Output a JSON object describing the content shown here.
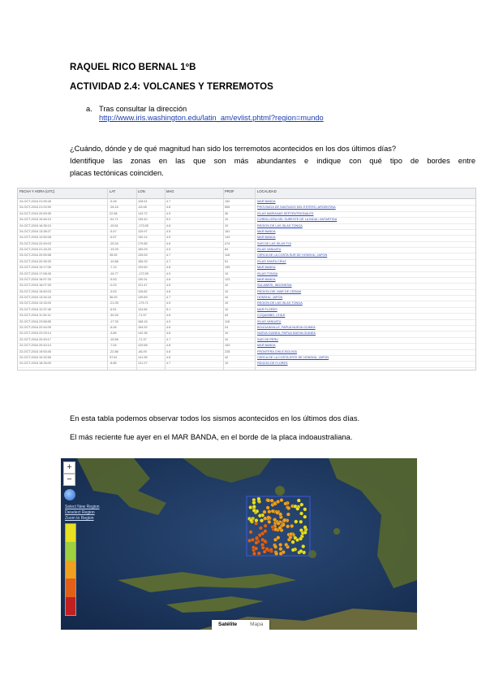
{
  "header": {
    "name": "RAQUEL RICO BERNAL 1ºB",
    "activity": "ACTIVIDAD 2.4: VOLCANES Y TERREMOTOS"
  },
  "list": {
    "marker": "a.",
    "text": "Tras consultar la dirección",
    "url": "http://www.iris.washington.edu/latin_am/evlist.phtml?region=mundo"
  },
  "question": {
    "line1": "¿Cuándo, dónde y de qué magnitud han sido los terremotos acontecidos en los dos últimos días?",
    "line2": "Identifique las zonas en las que son más abundantes e indique con qué tipo de bordes entre",
    "line3": "placas tectónicas coinciden."
  },
  "table": {
    "headers": [
      "FECHA Y HORA (UTC)",
      "LAT",
      "LON",
      "MAG",
      "PROF",
      "LOCALIDAD"
    ],
    "rows": [
      [
        "24-OCT-2016 21:59:45",
        "-5.28",
        "128.51",
        "4.7",
        "152",
        "MAR BANDA"
      ],
      [
        "24-OCT-2016 21:02:59",
        "-26.16",
        "-63.48",
        "4.8",
        "555",
        "PROVINCIA DE SANTIAGO DEL ESTERO, ARGENTINA"
      ],
      [
        "24-OCT-2016 20:59:35",
        "22.98",
        "143.72",
        "4.9",
        "30",
        "ISLAS MARIANAS SEPTENTRIONALES"
      ],
      [
        "24-OCT-2016 19:46:10",
        "-51.71",
        "139.40",
        "5.0",
        "10",
        "CORDILLERA DEL SURESTE DE LA INDIA / ANTARTIDA"
      ],
      [
        "24-OCT-2016 16:35:10",
        "-15.61",
        "-173.05",
        "4.8",
        "10",
        "REGION DE LAS ISLAS TONGA"
      ],
      [
        "24-OCT-2016 13:38:27",
        "-5.47",
        "129.97",
        "4.5",
        "161",
        "MAR BANDA"
      ],
      [
        "24-OCT-2016 12:50:08",
        "-5.57",
        "130.14",
        "4.9",
        "143",
        "MAR BANDA"
      ],
      [
        "23-OCT-2016 22:49:03",
        "-25.34",
        "179.85",
        "4.6",
        "474",
        "SUR DE LAS ISLAS FIJI"
      ],
      [
        "23-OCT-2016 21:16:20",
        "-19.29",
        "169.29",
        "4.5",
        "84",
        "ISLAS VANUATU"
      ],
      [
        "23-OCT-2016 20:59:58",
        "35.05",
        "139.53",
        "4.7",
        "118",
        "CERCA DE LA COSTA SUR DE HONSHU, JAPON"
      ],
      [
        "23-OCT-2016 20:35:33",
        "-10.88",
        "165.33",
        "4.7",
        "51",
        "ISLAS SANTA CRUZ"
      ],
      [
        "23-OCT-2016 19:17:06",
        "-7.13",
        "129.60",
        "4.8",
        "155",
        "MAR BANDA"
      ],
      [
        "23-OCT-2016 17:08:45",
        "-16.77",
        "-172.59",
        "4.9",
        "10",
        "ISLAS TONGA"
      ],
      [
        "23-OCT-2016 16:57:33",
        "-5.53",
        "130.31",
        "4.6",
        "123",
        "MAR BANDA"
      ],
      [
        "23-OCT-2016 16:07:39",
        "-0.23",
        "121.47",
        "4.5",
        "10",
        "SULAWESI, INDONESIA"
      ],
      [
        "23-OCT-2016 15:50:03",
        "-3.53",
        "126.82",
        "4.6",
        "10",
        "REGION DEL MAR DE CERAM"
      ],
      [
        "23-OCT-2016 13:34:16",
        "36.09",
        "139.89",
        "4.7",
        "44",
        "HONSHU, JAPON"
      ],
      [
        "23-OCT-2016 13:15:00",
        "-21.05",
        "-175.71",
        "4.9",
        "10",
        "REGION DE LAS ISLAS TONGA"
      ],
      [
        "23-OCT-2016 12:37:46",
        "-6.51",
        "124.84",
        "5.1",
        "10",
        "MAR FLORES"
      ],
      [
        "23-OCT-2016 11:33:14",
        "-30.26",
        "-71.57",
        "4.6",
        "43",
        "COQUIMBO, CHILE"
      ],
      [
        "22-OCT-2016 23:58:55",
        "-17.33",
        "168.16",
        "4.9",
        "116",
        "ISLAS VANUATU"
      ],
      [
        "22-OCT-2016 22:44:09",
        "-6.06",
        "154.92",
        "4.6",
        "24",
        "BOUGAINVILLE, PAPUA NUEVA GUINEA"
      ],
      [
        "22-OCT-2016 22:03:14",
        "-3.86",
        "142.36",
        "4.6",
        "10",
        "NUEVA GUINEA, PAPUA NUEVA GUINEA"
      ],
      [
        "22-OCT-2016 20:49:17",
        "-15.58",
        "-71.37",
        "4.7",
        "10",
        "SUR DE PERU"
      ],
      [
        "22-OCT-2016 20:43:14",
        "-7.04",
        "129.68",
        "4.8",
        "153",
        "MAR BANDA"
      ],
      [
        "22-OCT-2016 19:53:45",
        "-22.86",
        "-66.49",
        "4.6",
        "228",
        "FRONTERA CHILE-BOLIVIA"
      ],
      [
        "22-OCT-2016 19:32:56",
        "37.61",
        "141.55",
        "4.6",
        "42",
        "CERCA DE LA COSTA ESTE DE HONSHU, JAPON"
      ],
      [
        "22-OCT-2016 18:26:09",
        "-8.85",
        "121.27",
        "4.7",
        "10",
        "REGION DE FLORES"
      ],
      [
        "22-OCT-2016 17:51:51",
        "-2.77",
        "129.42",
        "4.6",
        "22",
        "REGION DEL MAR DE CERAM"
      ],
      [
        "22-OCT-2016 16:41:08",
        "-23.13",
        "-69.53",
        "4.5",
        "75",
        "ANTOFAGASTA, CHILE"
      ],
      [
        "22-OCT-2016 16:02:54",
        "-5.18",
        "130.11",
        "4.9",
        "168",
        "MAR BANDA"
      ],
      [
        "22-OCT-2016 15:37:05",
        "-36.47",
        "-73.44",
        "4.6",
        "34",
        "COSTA DEL BIO-BIO, CHILE"
      ],
      [
        "22-OCT-2016 14:11:11",
        "-6.81",
        "129.85",
        "4.5",
        "107",
        "MAR BANDA"
      ],
      [
        "22-OCT-2016 13:22:07",
        "-6.69",
        "130.03",
        "4.7",
        "187",
        "MAR BANDA"
      ],
      [
        "22-OCT-2016 12:09:02",
        "-4.12",
        "153.07",
        "4.8",
        "51",
        "NUEVA IRLANDA, PAPUA N. GUINEA"
      ],
      [
        "22-OCT-2016 11:43:29",
        "-15.27",
        "-174.51",
        "5.0",
        "10",
        "ISLAS TONGA"
      ],
      [
        "22-OCT-2016 11:10:40",
        "-5.31",
        "130.51",
        "4.6",
        "200",
        "MAR BANDA"
      ],
      [
        "22-OCT-2016 10:01:23",
        "-21.25",
        "-68.80",
        "4.7",
        "114",
        "ANTOFAGASTA, CHILE"
      ],
      [
        "22-OCT-2016 09:33:38",
        "-6.40",
        "129.90",
        "4.5",
        "157",
        "MAR BANDA"
      ],
      [
        "22-OCT-2016 08:55:12",
        "-35.00",
        "-71.50",
        "4.8",
        "32",
        "REGION DEL MAULE, CHILE"
      ],
      [
        "22-OCT-2016 08:02:01",
        "-5.90",
        "129.74",
        "4.6",
        "139",
        "MAR BANDA"
      ],
      [
        "22-OCT-2016 07:30:47",
        "-0.39",
        "-80.23",
        "4.6",
        "25",
        "COSTA DE ECUADOR"
      ],
      [
        "22-OCT-2016 06:43:25",
        "-20.18",
        "-69.31",
        "4.7",
        "96",
        "TARAPACA, CHILE"
      ],
      [
        "22-OCT-2016 06:01:54",
        "-6.27",
        "130.48",
        "4.9",
        "170",
        "MAR BANDA"
      ],
      [
        "22-OCT-2016 05:32:10",
        "-4.53",
        "129.29",
        "4.6",
        "153",
        "MAR BANDA"
      ],
      [
        "22-OCT-2016 04:51:36",
        "-36.09",
        "-72.89",
        "4.6",
        "20",
        "COSTA DEL MAULE, CHILE"
      ],
      [
        "22-OCT-2016 04:12:03",
        "-5.20",
        "128.94",
        "4.5",
        "172",
        "MAR BANDA"
      ],
      [
        "22-OCT-2016 03:27:52",
        "-5.65",
        "130.22",
        "4.9",
        "208",
        "MAR BANDA"
      ],
      [
        "22-OCT-2016 02:58:41",
        "-5.94",
        "130.10",
        "4.6",
        "208",
        "MAR BANDA"
      ]
    ]
  },
  "paragraph1": "En esta tabla podemos observar todos los sismos acontecidos en los últimos dos días.",
  "paragraph2": "El más reciente fue ayer en el MAR BANDA, en el borde de la placa indoaustraliana.",
  "map": {
    "zoom_in": "+",
    "zoom_out": "−",
    "links": [
      "Select New Region",
      "Deselect Region",
      "Zoom to Region"
    ],
    "toggle": [
      "Satélite",
      "Mapa"
    ],
    "colors": {
      "ocean": "#1c3a63",
      "land": "#4a5a30",
      "box": "#3b5ad8",
      "deep": "#e06018",
      "mid": "#f0a020",
      "shallow": "#e8e020"
    }
  }
}
